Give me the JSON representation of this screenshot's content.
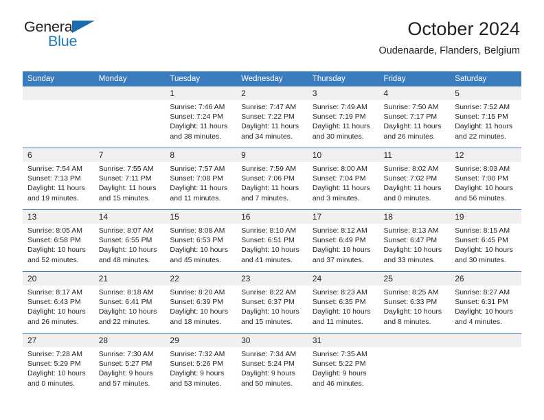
{
  "brand": {
    "name_part1": "General",
    "name_part2": "Blue",
    "triangle_icon": "triangle-icon",
    "accent_color": "#1f7bc1",
    "dark_color": "#231f20"
  },
  "header": {
    "title": "October 2024",
    "subtitle": "Oudenaarde, Flanders, Belgium"
  },
  "calendar": {
    "header_bg": "#3a7cbe",
    "daynum_bg": "#f0f0f0",
    "weekday_headers": [
      "Sunday",
      "Monday",
      "Tuesday",
      "Wednesday",
      "Thursday",
      "Friday",
      "Saturday"
    ],
    "weeks": [
      [
        {
          "day": "",
          "sunrise": "",
          "sunset": "",
          "daylight_line1": "",
          "daylight_line2": "",
          "empty": true
        },
        {
          "day": "",
          "sunrise": "",
          "sunset": "",
          "daylight_line1": "",
          "daylight_line2": "",
          "empty": true
        },
        {
          "day": "1",
          "sunrise": "Sunrise: 7:46 AM",
          "sunset": "Sunset: 7:24 PM",
          "daylight_line1": "Daylight: 11 hours",
          "daylight_line2": "and 38 minutes.",
          "empty": false
        },
        {
          "day": "2",
          "sunrise": "Sunrise: 7:47 AM",
          "sunset": "Sunset: 7:22 PM",
          "daylight_line1": "Daylight: 11 hours",
          "daylight_line2": "and 34 minutes.",
          "empty": false
        },
        {
          "day": "3",
          "sunrise": "Sunrise: 7:49 AM",
          "sunset": "Sunset: 7:19 PM",
          "daylight_line1": "Daylight: 11 hours",
          "daylight_line2": "and 30 minutes.",
          "empty": false
        },
        {
          "day": "4",
          "sunrise": "Sunrise: 7:50 AM",
          "sunset": "Sunset: 7:17 PM",
          "daylight_line1": "Daylight: 11 hours",
          "daylight_line2": "and 26 minutes.",
          "empty": false
        },
        {
          "day": "5",
          "sunrise": "Sunrise: 7:52 AM",
          "sunset": "Sunset: 7:15 PM",
          "daylight_line1": "Daylight: 11 hours",
          "daylight_line2": "and 22 minutes.",
          "empty": false
        }
      ],
      [
        {
          "day": "6",
          "sunrise": "Sunrise: 7:54 AM",
          "sunset": "Sunset: 7:13 PM",
          "daylight_line1": "Daylight: 11 hours",
          "daylight_line2": "and 19 minutes.",
          "empty": false
        },
        {
          "day": "7",
          "sunrise": "Sunrise: 7:55 AM",
          "sunset": "Sunset: 7:11 PM",
          "daylight_line1": "Daylight: 11 hours",
          "daylight_line2": "and 15 minutes.",
          "empty": false
        },
        {
          "day": "8",
          "sunrise": "Sunrise: 7:57 AM",
          "sunset": "Sunset: 7:08 PM",
          "daylight_line1": "Daylight: 11 hours",
          "daylight_line2": "and 11 minutes.",
          "empty": false
        },
        {
          "day": "9",
          "sunrise": "Sunrise: 7:59 AM",
          "sunset": "Sunset: 7:06 PM",
          "daylight_line1": "Daylight: 11 hours",
          "daylight_line2": "and 7 minutes.",
          "empty": false
        },
        {
          "day": "10",
          "sunrise": "Sunrise: 8:00 AM",
          "sunset": "Sunset: 7:04 PM",
          "daylight_line1": "Daylight: 11 hours",
          "daylight_line2": "and 3 minutes.",
          "empty": false
        },
        {
          "day": "11",
          "sunrise": "Sunrise: 8:02 AM",
          "sunset": "Sunset: 7:02 PM",
          "daylight_line1": "Daylight: 11 hours",
          "daylight_line2": "and 0 minutes.",
          "empty": false
        },
        {
          "day": "12",
          "sunrise": "Sunrise: 8:03 AM",
          "sunset": "Sunset: 7:00 PM",
          "daylight_line1": "Daylight: 10 hours",
          "daylight_line2": "and 56 minutes.",
          "empty": false
        }
      ],
      [
        {
          "day": "13",
          "sunrise": "Sunrise: 8:05 AM",
          "sunset": "Sunset: 6:58 PM",
          "daylight_line1": "Daylight: 10 hours",
          "daylight_line2": "and 52 minutes.",
          "empty": false
        },
        {
          "day": "14",
          "sunrise": "Sunrise: 8:07 AM",
          "sunset": "Sunset: 6:55 PM",
          "daylight_line1": "Daylight: 10 hours",
          "daylight_line2": "and 48 minutes.",
          "empty": false
        },
        {
          "day": "15",
          "sunrise": "Sunrise: 8:08 AM",
          "sunset": "Sunset: 6:53 PM",
          "daylight_line1": "Daylight: 10 hours",
          "daylight_line2": "and 45 minutes.",
          "empty": false
        },
        {
          "day": "16",
          "sunrise": "Sunrise: 8:10 AM",
          "sunset": "Sunset: 6:51 PM",
          "daylight_line1": "Daylight: 10 hours",
          "daylight_line2": "and 41 minutes.",
          "empty": false
        },
        {
          "day": "17",
          "sunrise": "Sunrise: 8:12 AM",
          "sunset": "Sunset: 6:49 PM",
          "daylight_line1": "Daylight: 10 hours",
          "daylight_line2": "and 37 minutes.",
          "empty": false
        },
        {
          "day": "18",
          "sunrise": "Sunrise: 8:13 AM",
          "sunset": "Sunset: 6:47 PM",
          "daylight_line1": "Daylight: 10 hours",
          "daylight_line2": "and 33 minutes.",
          "empty": false
        },
        {
          "day": "19",
          "sunrise": "Sunrise: 8:15 AM",
          "sunset": "Sunset: 6:45 PM",
          "daylight_line1": "Daylight: 10 hours",
          "daylight_line2": "and 30 minutes.",
          "empty": false
        }
      ],
      [
        {
          "day": "20",
          "sunrise": "Sunrise: 8:17 AM",
          "sunset": "Sunset: 6:43 PM",
          "daylight_line1": "Daylight: 10 hours",
          "daylight_line2": "and 26 minutes.",
          "empty": false
        },
        {
          "day": "21",
          "sunrise": "Sunrise: 8:18 AM",
          "sunset": "Sunset: 6:41 PM",
          "daylight_line1": "Daylight: 10 hours",
          "daylight_line2": "and 22 minutes.",
          "empty": false
        },
        {
          "day": "22",
          "sunrise": "Sunrise: 8:20 AM",
          "sunset": "Sunset: 6:39 PM",
          "daylight_line1": "Daylight: 10 hours",
          "daylight_line2": "and 18 minutes.",
          "empty": false
        },
        {
          "day": "23",
          "sunrise": "Sunrise: 8:22 AM",
          "sunset": "Sunset: 6:37 PM",
          "daylight_line1": "Daylight: 10 hours",
          "daylight_line2": "and 15 minutes.",
          "empty": false
        },
        {
          "day": "24",
          "sunrise": "Sunrise: 8:23 AM",
          "sunset": "Sunset: 6:35 PM",
          "daylight_line1": "Daylight: 10 hours",
          "daylight_line2": "and 11 minutes.",
          "empty": false
        },
        {
          "day": "25",
          "sunrise": "Sunrise: 8:25 AM",
          "sunset": "Sunset: 6:33 PM",
          "daylight_line1": "Daylight: 10 hours",
          "daylight_line2": "and 8 minutes.",
          "empty": false
        },
        {
          "day": "26",
          "sunrise": "Sunrise: 8:27 AM",
          "sunset": "Sunset: 6:31 PM",
          "daylight_line1": "Daylight: 10 hours",
          "daylight_line2": "and 4 minutes.",
          "empty": false
        }
      ],
      [
        {
          "day": "27",
          "sunrise": "Sunrise: 7:28 AM",
          "sunset": "Sunset: 5:29 PM",
          "daylight_line1": "Daylight: 10 hours",
          "daylight_line2": "and 0 minutes.",
          "empty": false
        },
        {
          "day": "28",
          "sunrise": "Sunrise: 7:30 AM",
          "sunset": "Sunset: 5:27 PM",
          "daylight_line1": "Daylight: 9 hours",
          "daylight_line2": "and 57 minutes.",
          "empty": false
        },
        {
          "day": "29",
          "sunrise": "Sunrise: 7:32 AM",
          "sunset": "Sunset: 5:26 PM",
          "daylight_line1": "Daylight: 9 hours",
          "daylight_line2": "and 53 minutes.",
          "empty": false
        },
        {
          "day": "30",
          "sunrise": "Sunrise: 7:34 AM",
          "sunset": "Sunset: 5:24 PM",
          "daylight_line1": "Daylight: 9 hours",
          "daylight_line2": "and 50 minutes.",
          "empty": false
        },
        {
          "day": "31",
          "sunrise": "Sunrise: 7:35 AM",
          "sunset": "Sunset: 5:22 PM",
          "daylight_line1": "Daylight: 9 hours",
          "daylight_line2": "and 46 minutes.",
          "empty": false
        },
        {
          "day": "",
          "sunrise": "",
          "sunset": "",
          "daylight_line1": "",
          "daylight_line2": "",
          "empty": true
        },
        {
          "day": "",
          "sunrise": "",
          "sunset": "",
          "daylight_line1": "",
          "daylight_line2": "",
          "empty": true
        }
      ]
    ]
  }
}
